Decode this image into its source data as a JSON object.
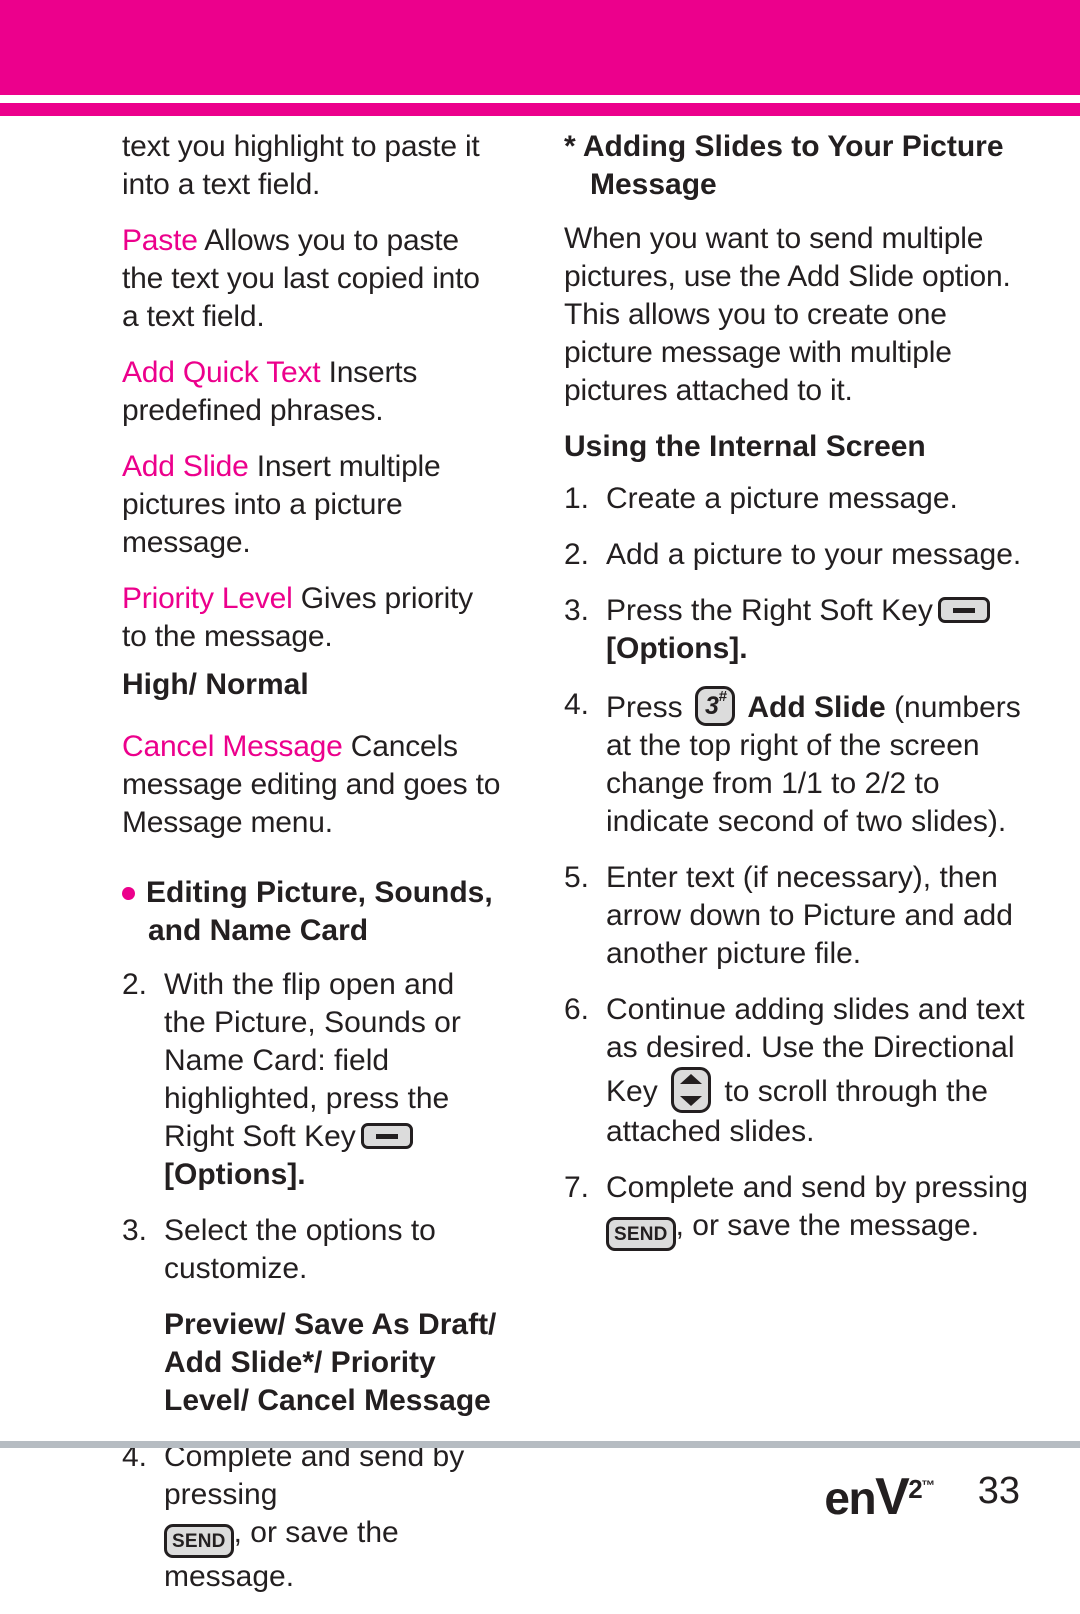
{
  "theme": {
    "accent_pink": "#ec008c",
    "text_color": "#231f20",
    "rule_gray": "#b6bcc2"
  },
  "left_column": {
    "continued_paragraph": "text you highlight to paste it into a text field.",
    "definitions": [
      {
        "term": "Paste",
        "description": "Allows you to paste the text you last copied into a text field."
      },
      {
        "term": "Add Quick Text",
        "description": "Inserts predefined phrases."
      },
      {
        "term": "Add Slide",
        "description": "Insert multiple pictures into a picture message."
      },
      {
        "term": "Priority Level",
        "description": "Gives priority to the message.",
        "options": "High/ Normal"
      },
      {
        "term": "Cancel Message",
        "description": "Cancels message editing and goes to Message menu."
      }
    ],
    "section_heading": "Editing Picture, Sounds, and Name Card",
    "steps": [
      {
        "number": "2.",
        "text_before_key": "With the flip open and the Picture, Sounds or Name Card: field highlighted, press the Right Soft Key",
        "key": "right-soft-key",
        "text_after_key": "[Options]."
      },
      {
        "number": "3.",
        "text": "Select the options to customize."
      },
      {
        "number": "4.",
        "text_before_key": "Complete and send by pressing",
        "key": "send-key",
        "key_label": "SEND",
        "text_after_key": ", or save the message."
      }
    ],
    "options_list": "Preview/ Save As Draft/ Add Slide*/ Priority Level/  Cancel Message"
  },
  "right_column": {
    "starred_heading": "* Adding Slides to Your Picture Message",
    "intro_paragraph": "When you want to send multiple pictures, use the Add Slide option. This allows you to create one picture message with multiple pictures attached to it.",
    "sub_heading": "Using the Internal Screen",
    "steps": [
      {
        "number": "1.",
        "text": "Create a picture message."
      },
      {
        "number": "2.",
        "text": "Add a picture to your message."
      },
      {
        "number": "3.",
        "text_before_key": "Press the Right Soft Key",
        "key": "right-soft-key",
        "text_after_key": "[Options]."
      },
      {
        "number": "4.",
        "text_before_key": "Press",
        "key": "number-3-key",
        "key_digit": "3",
        "key_sup": "#",
        "bold_term": "Add Slide",
        "text_after_key": "(numbers at the top right of the screen change from 1/1 to 2/2 to indicate second of two slides)."
      },
      {
        "number": "5.",
        "text": "Enter text (if necessary), then arrow down to Picture and add another picture file."
      },
      {
        "number": "6.",
        "text_before_key": "Continue adding slides and text as desired. Use the Directional Key",
        "key": "directional-key",
        "text_after_key": "to scroll through the attached slides."
      },
      {
        "number": "7.",
        "text_before_key": "Complete and send by pressing",
        "key": "send-key",
        "key_label": "SEND",
        "text_after_key": ", or save the message."
      }
    ]
  },
  "footer": {
    "brand_en": "en",
    "brand_v": "V",
    "brand_sup": "2",
    "brand_tm": "™",
    "page_number": "33"
  }
}
